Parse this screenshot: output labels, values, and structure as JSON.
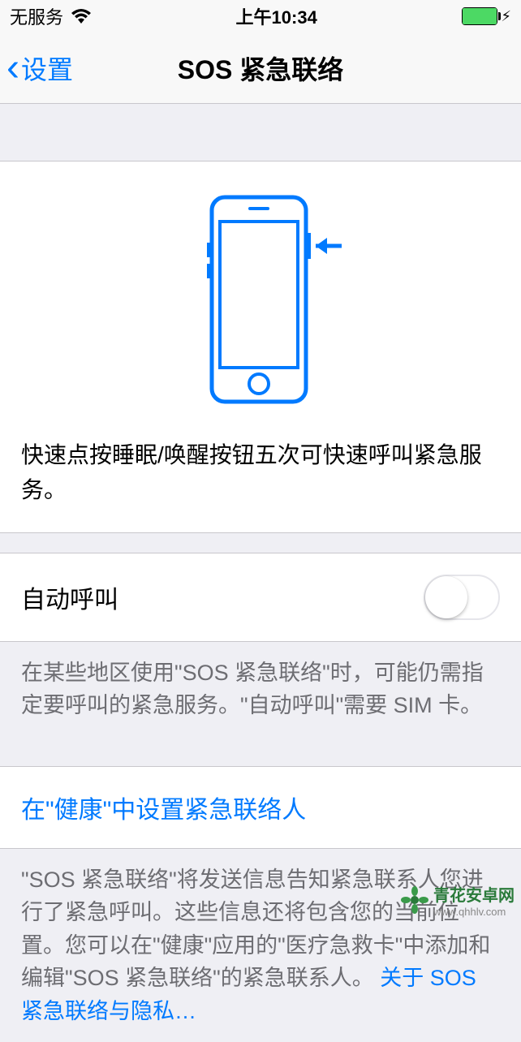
{
  "status_bar": {
    "carrier": "无服务",
    "time": "上午10:34"
  },
  "nav": {
    "back_label": "设置",
    "title": "SOS 紧急联络"
  },
  "hero": {
    "instruction": "快速点按睡眠/唤醒按钮五次可快速呼叫紧急服务。"
  },
  "auto_call": {
    "label": "自动呼叫",
    "enabled": false,
    "footer": "在某些地区使用\"SOS 紧急联络\"时，可能仍需指定要呼叫的紧急服务。\"自动呼叫\"需要 SIM 卡。"
  },
  "health_link": {
    "label": "在\"健康\"中设置紧急联络人",
    "footer": "\"SOS 紧急联络\"将发送信息告知紧急联系人您进行了紧急呼叫。这些信息还将包含您的当前位置。您可以在\"健康\"应用的\"医疗急救卡\"中添加和编辑\"SOS 紧急联络\"的紧急联系人。",
    "privacy_link": "关于 SOS 紧急联络与隐私…"
  },
  "watermark": {
    "title": "青花安卓网",
    "url": "www.qhhlv.com"
  }
}
